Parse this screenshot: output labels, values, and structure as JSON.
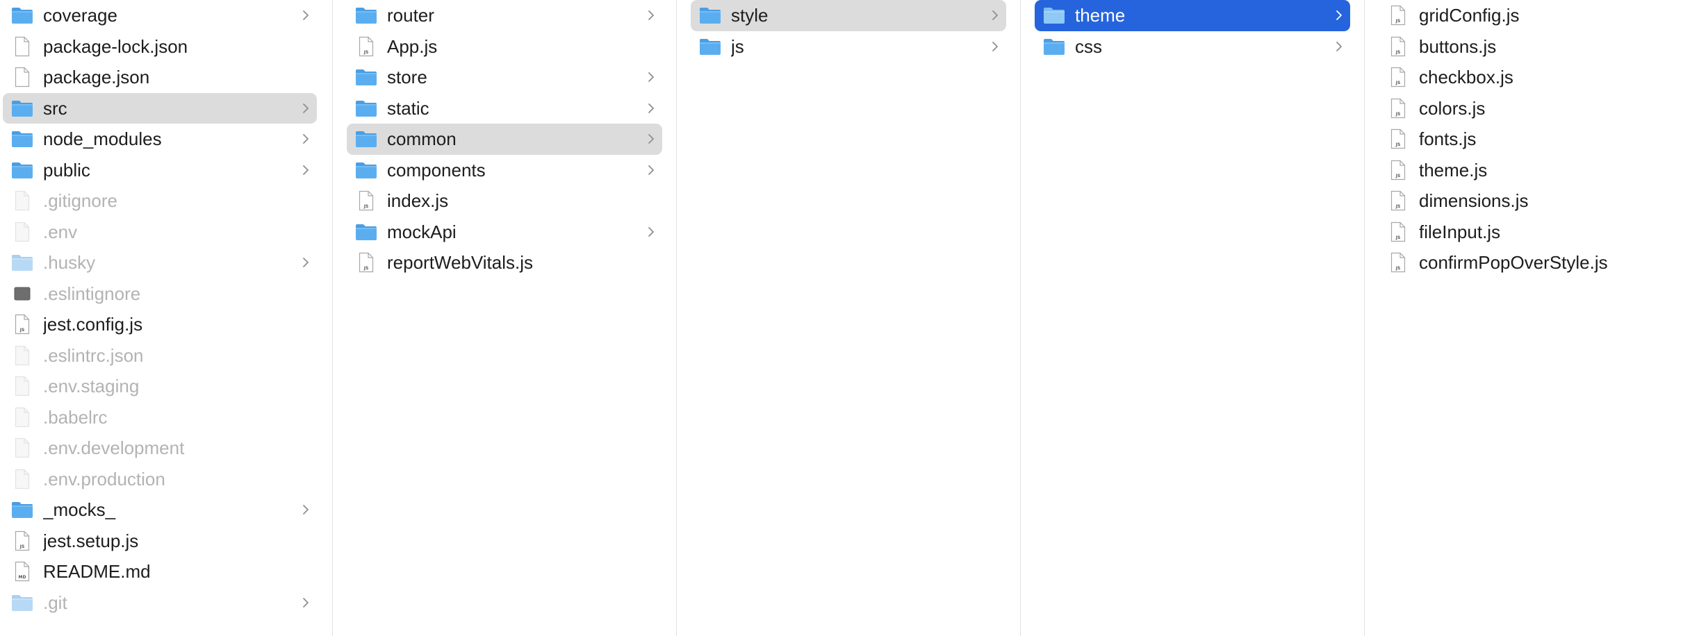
{
  "columns": [
    {
      "items": [
        {
          "name": "coverage",
          "kind": "folder",
          "dim": false,
          "selected": "",
          "chevron": true
        },
        {
          "name": "package-lock.json",
          "kind": "file",
          "dim": false,
          "selected": "",
          "chevron": false
        },
        {
          "name": "package.json",
          "kind": "file",
          "dim": false,
          "selected": "",
          "chevron": false
        },
        {
          "name": "src",
          "kind": "folder",
          "dim": false,
          "selected": "grey",
          "chevron": true
        },
        {
          "name": "node_modules",
          "kind": "folder",
          "dim": false,
          "selected": "",
          "chevron": true
        },
        {
          "name": "public",
          "kind": "folder",
          "dim": false,
          "selected": "",
          "chevron": true
        },
        {
          "name": ".gitignore",
          "kind": "file",
          "dim": true,
          "selected": "",
          "chevron": false
        },
        {
          "name": ".env",
          "kind": "file",
          "dim": true,
          "selected": "",
          "chevron": false
        },
        {
          "name": ".husky",
          "kind": "folder",
          "dim": true,
          "selected": "",
          "chevron": true
        },
        {
          "name": ".eslintignore",
          "kind": "darkfile",
          "dim": true,
          "selected": "",
          "chevron": false
        },
        {
          "name": "jest.config.js",
          "kind": "jsfile",
          "dim": false,
          "selected": "",
          "chevron": false
        },
        {
          "name": ".eslintrc.json",
          "kind": "file",
          "dim": true,
          "selected": "",
          "chevron": false
        },
        {
          "name": ".env.staging",
          "kind": "file",
          "dim": true,
          "selected": "",
          "chevron": false
        },
        {
          "name": ".babelrc",
          "kind": "file",
          "dim": true,
          "selected": "",
          "chevron": false
        },
        {
          "name": ".env.development",
          "kind": "file",
          "dim": true,
          "selected": "",
          "chevron": false
        },
        {
          "name": ".env.production",
          "kind": "file",
          "dim": true,
          "selected": "",
          "chevron": false
        },
        {
          "name": "_mocks_",
          "kind": "folder",
          "dim": false,
          "selected": "",
          "chevron": true
        },
        {
          "name": "jest.setup.js",
          "kind": "jsfile",
          "dim": false,
          "selected": "",
          "chevron": false
        },
        {
          "name": "README.md",
          "kind": "mdfile",
          "dim": false,
          "selected": "",
          "chevron": false
        },
        {
          "name": ".git",
          "kind": "folder",
          "dim": true,
          "selected": "",
          "chevron": true
        }
      ]
    },
    {
      "items": [
        {
          "name": "router",
          "kind": "folder",
          "dim": false,
          "selected": "",
          "chevron": true
        },
        {
          "name": "App.js",
          "kind": "jsfile",
          "dim": false,
          "selected": "",
          "chevron": false
        },
        {
          "name": "store",
          "kind": "folder",
          "dim": false,
          "selected": "",
          "chevron": true
        },
        {
          "name": "static",
          "kind": "folder",
          "dim": false,
          "selected": "",
          "chevron": true
        },
        {
          "name": "common",
          "kind": "folder",
          "dim": false,
          "selected": "grey",
          "chevron": true
        },
        {
          "name": "components",
          "kind": "folder",
          "dim": false,
          "selected": "",
          "chevron": true
        },
        {
          "name": "index.js",
          "kind": "jsfile",
          "dim": false,
          "selected": "",
          "chevron": false
        },
        {
          "name": "mockApi",
          "kind": "folder",
          "dim": false,
          "selected": "",
          "chevron": true
        },
        {
          "name": "reportWebVitals.js",
          "kind": "jsfile",
          "dim": false,
          "selected": "",
          "chevron": false
        }
      ]
    },
    {
      "items": [
        {
          "name": "style",
          "kind": "folder",
          "dim": false,
          "selected": "grey",
          "chevron": true
        },
        {
          "name": "js",
          "kind": "folder",
          "dim": false,
          "selected": "",
          "chevron": true
        }
      ]
    },
    {
      "items": [
        {
          "name": "theme",
          "kind": "folder",
          "dim": false,
          "selected": "blue",
          "chevron": true
        },
        {
          "name": "css",
          "kind": "folder",
          "dim": false,
          "selected": "",
          "chevron": true
        }
      ]
    },
    {
      "items": [
        {
          "name": "gridConfig.js",
          "kind": "jsfile",
          "dim": false,
          "selected": "",
          "chevron": false
        },
        {
          "name": "buttons.js",
          "kind": "jsfile",
          "dim": false,
          "selected": "",
          "chevron": false
        },
        {
          "name": "checkbox.js",
          "kind": "jsfile",
          "dim": false,
          "selected": "",
          "chevron": false
        },
        {
          "name": "colors.js",
          "kind": "jsfile",
          "dim": false,
          "selected": "",
          "chevron": false
        },
        {
          "name": "fonts.js",
          "kind": "jsfile",
          "dim": false,
          "selected": "",
          "chevron": false
        },
        {
          "name": "theme.js",
          "kind": "jsfile",
          "dim": false,
          "selected": "",
          "chevron": false
        },
        {
          "name": "dimensions.js",
          "kind": "jsfile",
          "dim": false,
          "selected": "",
          "chevron": false
        },
        {
          "name": "fileInput.js",
          "kind": "jsfile",
          "dim": false,
          "selected": "",
          "chevron": false
        },
        {
          "name": "confirmPopOverStyle.js",
          "kind": "jsfile",
          "dim": false,
          "selected": "",
          "chevron": false
        }
      ]
    }
  ],
  "colors": {
    "folder_body": "#5aaef0",
    "folder_tab": "#4a9ee3",
    "selection_grey": "#dcdcdc",
    "selection_blue": "#2564dc"
  }
}
